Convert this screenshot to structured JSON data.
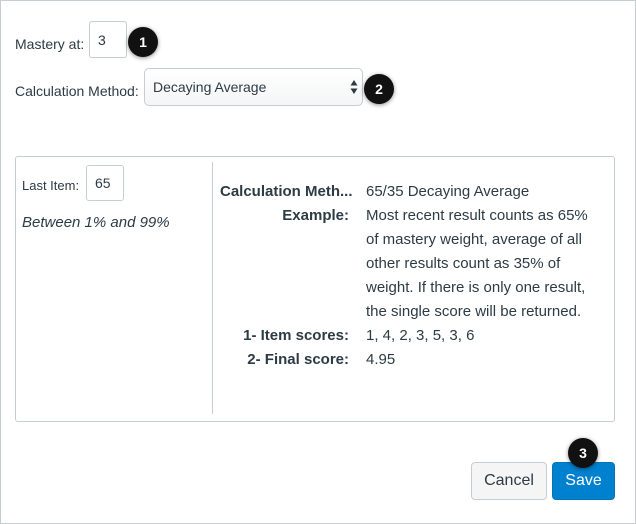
{
  "mastery": {
    "label": "Mastery at:",
    "value": "3"
  },
  "calculation": {
    "label": "Calculation Method:",
    "selected": "Decaying Average"
  },
  "last_item": {
    "label": "Last Item:",
    "value": "65",
    "hint": "Between 1% and 99%"
  },
  "details": [
    {
      "term": "Calculation Meth...",
      "desc": "65/35 Decaying Average"
    },
    {
      "term": "Example:",
      "desc": "Most recent result counts as 65% of mastery weight, average of all other results count as 35% of weight. If there is only one result, the single score will be returned."
    },
    {
      "term": "1- Item scores:",
      "desc": "1, 4, 2, 3, 5, 3, 6"
    },
    {
      "term": "2- Final score:",
      "desc": "4.95"
    }
  ],
  "buttons": {
    "cancel": "Cancel",
    "save": "Save"
  },
  "badges": {
    "one": "1",
    "two": "2",
    "three": "3"
  },
  "colors": {
    "primary": "#0081cf",
    "border": "#c7cdd1",
    "text": "#2d3b45",
    "badge": "#111111"
  }
}
